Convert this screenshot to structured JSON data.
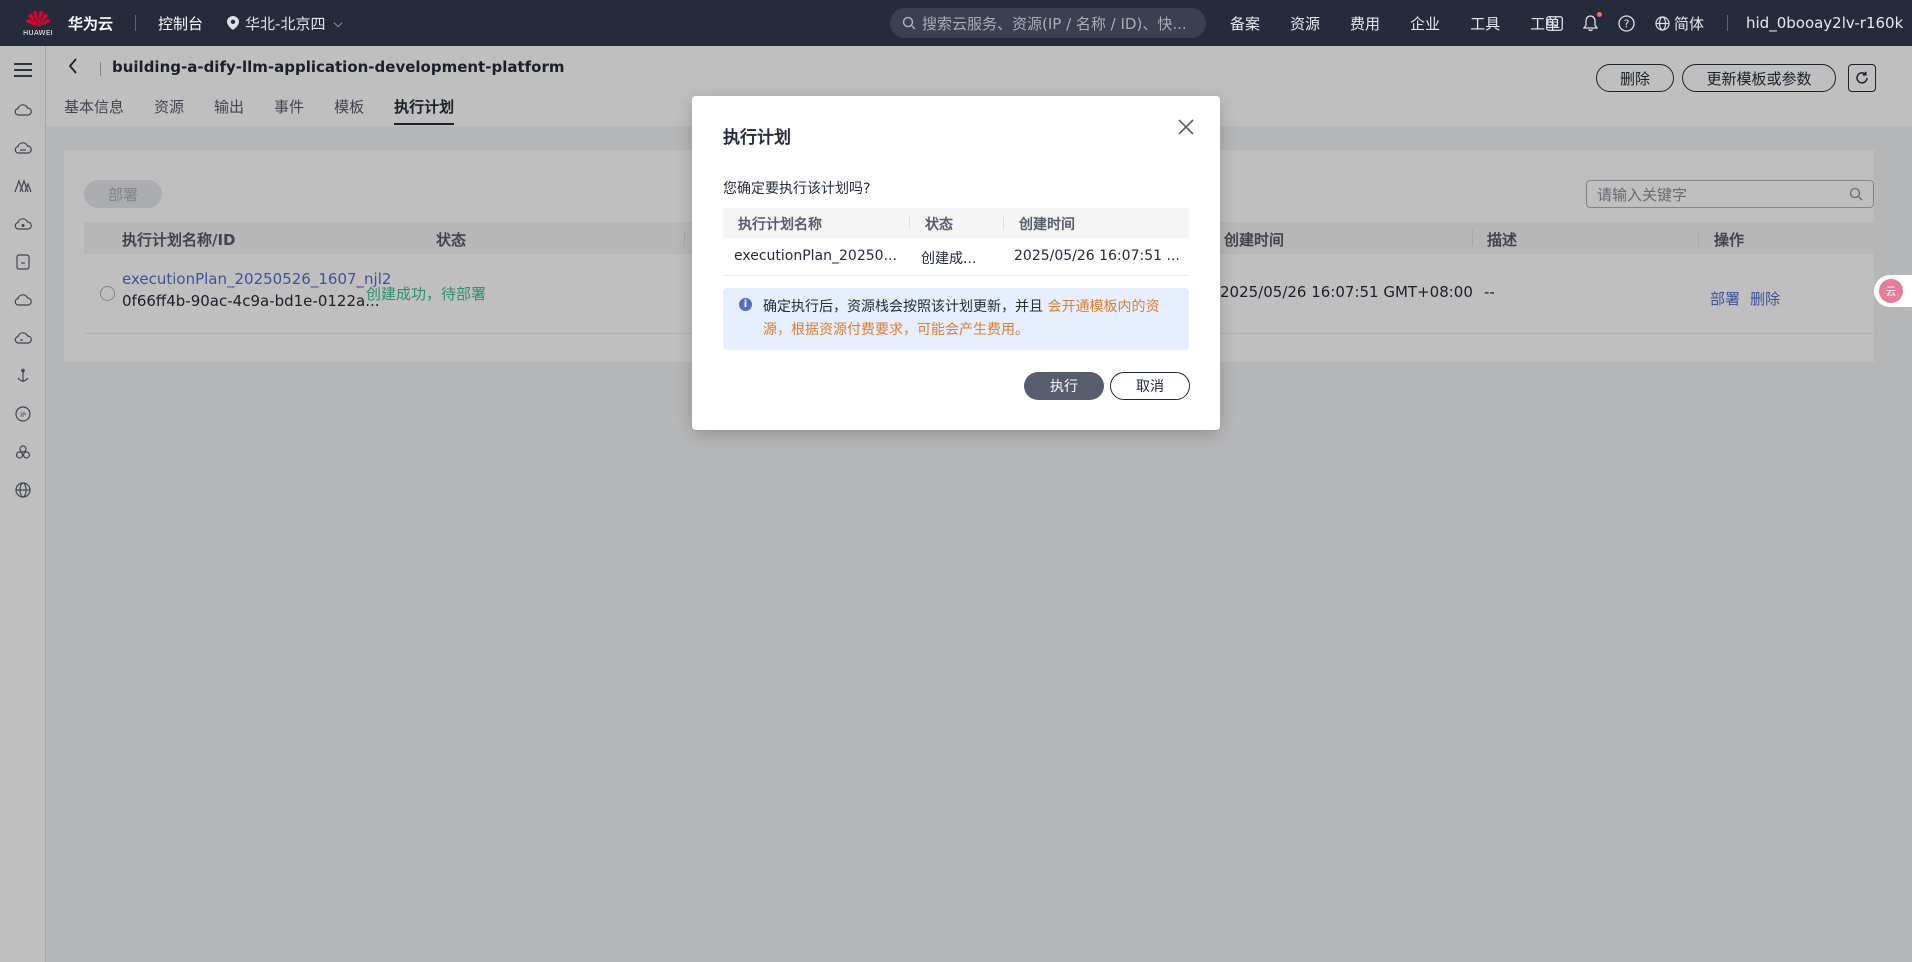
{
  "topbar": {
    "logo_text": "HUAWEI",
    "brand": "华为云",
    "console": "控制台",
    "region": "华北-北京四",
    "search_placeholder": "搜索云服务、资源(IP / 名称 / ID)、快...",
    "nav": [
      "备案",
      "资源",
      "费用",
      "企业",
      "工具",
      "工单"
    ],
    "language": "简体",
    "user": "hid_0booay2lv-r160k",
    "colors": {
      "bg": "#252b3a",
      "notify_dot": "#f66f6a"
    }
  },
  "page": {
    "title": "building-a-dify-llm-application-development-platform",
    "tabs": [
      "基本信息",
      "资源",
      "输出",
      "事件",
      "模板",
      "执行计划"
    ],
    "active_tab": "执行计划",
    "delete_label": "删除",
    "update_label": "更新模板或参数"
  },
  "table": {
    "deploy_label": "部署",
    "search_placeholder": "请输入关键字",
    "headers": {
      "name": "执行计划名称/ID",
      "status": "状态",
      "created": "创建时间",
      "desc": "描述",
      "ops": "操作"
    },
    "row": {
      "name": "executionPlan_20250526_1607_njl2",
      "id": "0f66ff4b-90ac-4c9a-bd1e-0122a...",
      "status": "创建成功，待部署",
      "created": "2025/05/26 16:07:51 GMT+08:00",
      "desc": "--",
      "op_deploy": "部署",
      "op_delete": "删除"
    },
    "colors": {
      "link": "#526ecc",
      "success": "#3ac295"
    }
  },
  "modal": {
    "title": "执行计划",
    "question": "您确定要执行该计划吗?",
    "headers": {
      "name": "执行计划名称",
      "status": "状态",
      "created": "创建时间"
    },
    "row": {
      "name": "executionPlan_20250...",
      "status": "创建成...",
      "created": "2025/05/26 16:07:51 ..."
    },
    "alert_text": "确定执行后，资源栈会按照该计划更新，并且",
    "alert_warn": "会开通模板内的资源，根据资源付费要求，可能会产生费用。",
    "execute_label": "执行",
    "cancel_label": "取消",
    "colors": {
      "alert_bg": "#e5efff",
      "warn": "#e37d29",
      "primary": "#575d6c"
    }
  },
  "float_widget": {
    "label": "云"
  }
}
